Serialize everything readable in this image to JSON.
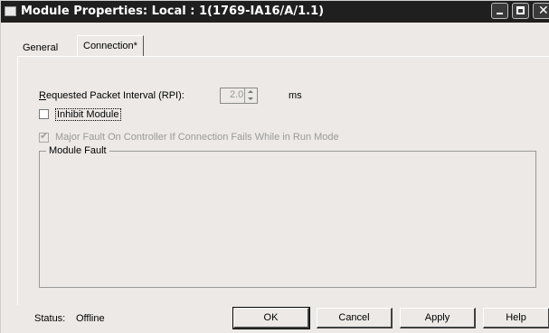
{
  "window": {
    "title": "Module Properties: Local : 1(1769-IA16/A/1.1)"
  },
  "tabs": [
    {
      "label": "General"
    },
    {
      "label": "Connection*"
    }
  ],
  "connection": {
    "rpi_label": "Requested Packet Interval (RPI):",
    "rpi_value": "2.0",
    "rpi_unit": "ms",
    "inhibit_label": "Inhibit Module",
    "inhibit_checked": false,
    "major_fault_label": "Major Fault On Controller If Connection Fails While in Run Mode",
    "major_fault_checked": true,
    "module_fault_label": "Module Fault"
  },
  "footer": {
    "status_label": "Status:",
    "status_value": "Offline",
    "ok_label": "OK",
    "cancel_label": "Cancel",
    "apply_label": "Apply",
    "help_label": "Help"
  }
}
